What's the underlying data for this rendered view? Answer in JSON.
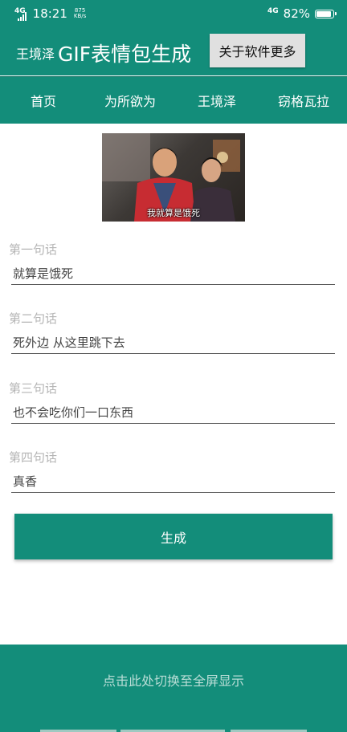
{
  "status": {
    "network": "4G",
    "time": "18:21",
    "speed_value": "875",
    "speed_unit": "KB/s",
    "network_right": "4G",
    "battery": "82%"
  },
  "header": {
    "author": "王境泽",
    "title": "GIF表情包生成",
    "about_button": "关于软件更多"
  },
  "tabs": [
    {
      "label": "首页"
    },
    {
      "label": "为所欲为"
    },
    {
      "label": "王境泽"
    },
    {
      "label": "窃格瓦拉"
    }
  ],
  "preview": {
    "caption": "我就算是饿死"
  },
  "fields": [
    {
      "label": "第一句话",
      "value": "就算是饿死"
    },
    {
      "label": "第二句话",
      "value": "死外边 从这里跳下去"
    },
    {
      "label": "第三句话",
      "value": "也不会吃你们一口东西"
    },
    {
      "label": "第四句话",
      "value": "真香"
    }
  ],
  "generate_button": "生成",
  "bottom": {
    "fullscreen_hint": "点击此处切换至全屏显示"
  },
  "colors": {
    "primary": "#138d7a",
    "button_gray": "#e0e0e0",
    "label_gray": "#b5b5b5"
  }
}
